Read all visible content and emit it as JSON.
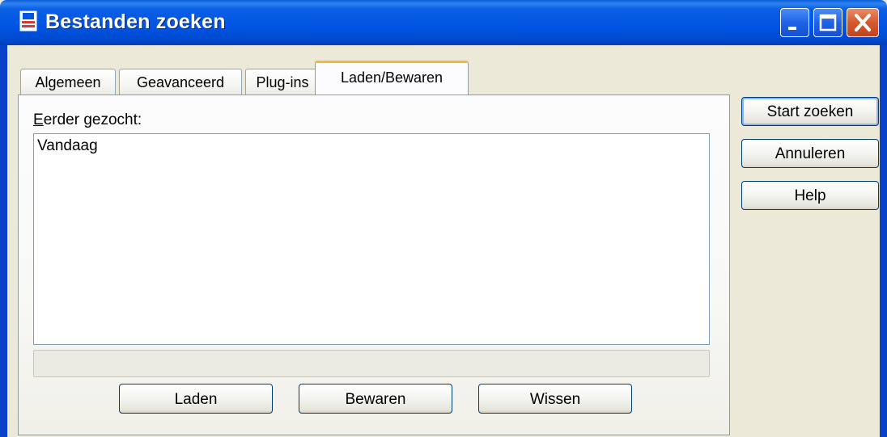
{
  "window": {
    "title": "Bestanden zoeken",
    "controls": [
      "minimize",
      "maximize",
      "close"
    ],
    "accent_color": "#0054e3",
    "close_color": "#d6582e"
  },
  "tabs": [
    {
      "label": "Algemeen",
      "active": false
    },
    {
      "label": "Geavanceerd",
      "active": false
    },
    {
      "label": "Plug-ins",
      "active": false
    },
    {
      "label": "Laden/Bewaren",
      "active": true
    }
  ],
  "panel": {
    "list_label_mnemonic": "E",
    "list_label_rest": "erder gezocht:",
    "items": [
      "Vandaag"
    ],
    "buttons": {
      "load": "Laden",
      "save": "Bewaren",
      "clear": "Wissen"
    }
  },
  "side_buttons": {
    "start": "Start zoeken",
    "cancel": "Annuleren",
    "help": "Help"
  }
}
